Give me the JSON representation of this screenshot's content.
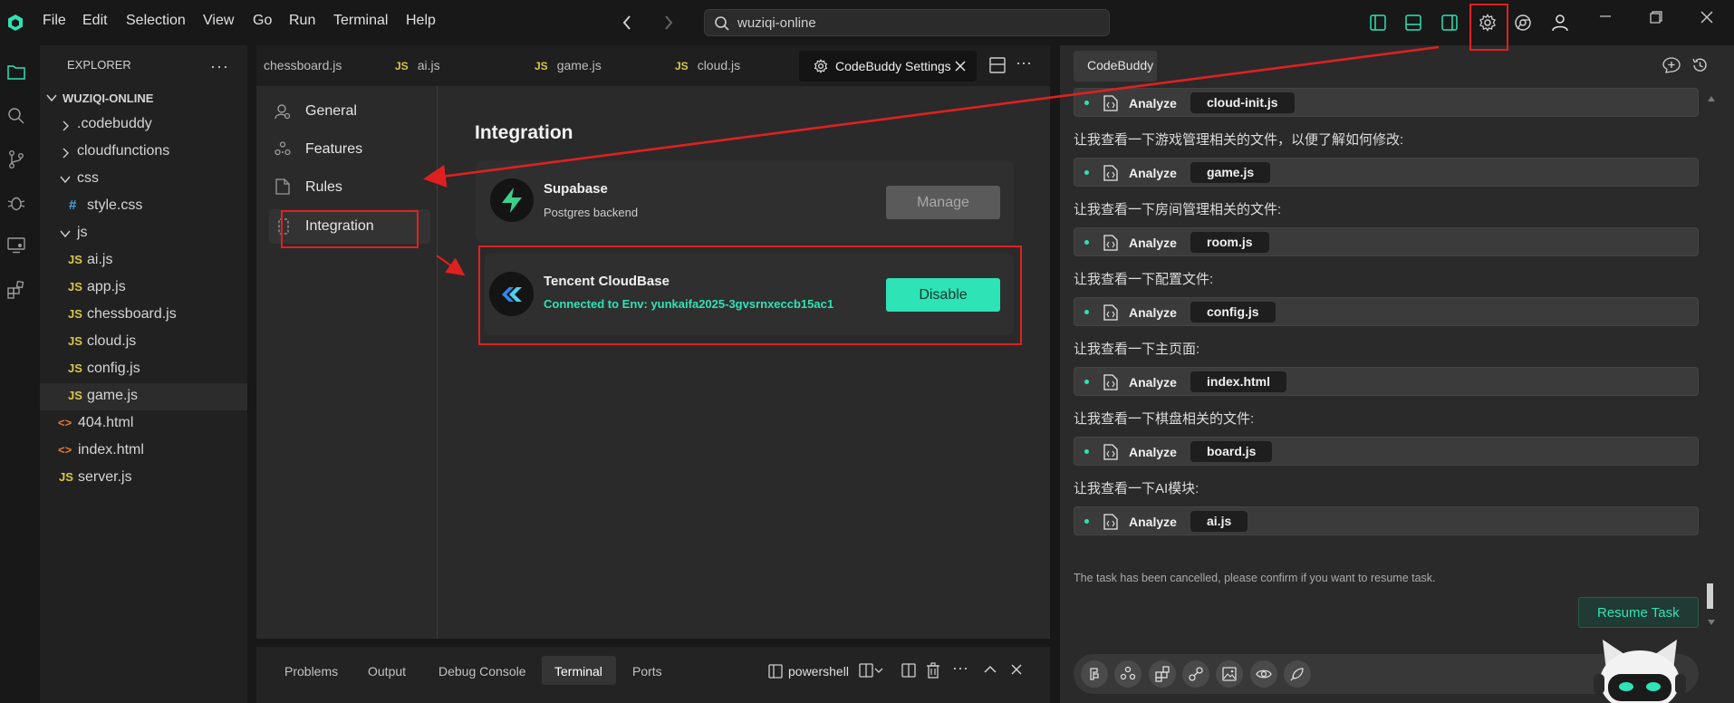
{
  "menu": [
    "File",
    "Edit",
    "Selection",
    "View",
    "Go",
    "Run",
    "Terminal",
    "Help"
  ],
  "search": {
    "value": "wuziqi-online"
  },
  "explorer": {
    "header": "EXPLORER",
    "root": "WUZIQI-ONLINE",
    "items": [
      {
        "label": ".codebuddy",
        "type": "folder-closed"
      },
      {
        "label": "cloudfunctions",
        "type": "folder-closed"
      },
      {
        "label": "css",
        "type": "folder-open"
      },
      {
        "label": "style.css",
        "type": "css"
      },
      {
        "label": "js",
        "type": "folder-open"
      },
      {
        "label": "ai.js",
        "type": "js"
      },
      {
        "label": "app.js",
        "type": "js"
      },
      {
        "label": "chessboard.js",
        "type": "js"
      },
      {
        "label": "cloud.js",
        "type": "js"
      },
      {
        "label": "config.js",
        "type": "js"
      },
      {
        "label": "game.js",
        "type": "js"
      },
      {
        "label": "404.html",
        "type": "html"
      },
      {
        "label": "index.html",
        "type": "html"
      },
      {
        "label": "server.js",
        "type": "js"
      }
    ]
  },
  "tabs": [
    {
      "label": "chessboard.js"
    },
    {
      "label": "ai.js"
    },
    {
      "label": "game.js"
    },
    {
      "label": "cloud.js"
    },
    {
      "label": "CodeBuddy Settings"
    }
  ],
  "js_badge": "JS",
  "settings": {
    "nav": [
      "General",
      "Features",
      "Rules",
      "Integration"
    ],
    "heading": "Integration",
    "integrations": [
      {
        "name": "Supabase",
        "desc": "Postgres backend",
        "button": "Manage"
      },
      {
        "name": "Tencent CloudBase",
        "desc": "Connected to Env: yunkaifa2025-3gvsrnxeccb15ac1",
        "button": "Disable"
      }
    ]
  },
  "panel": {
    "tabs": [
      "Problems",
      "Output",
      "Debug Console",
      "Terminal",
      "Ports"
    ],
    "shell": "powershell"
  },
  "codebuddy": {
    "title": "CodeBuddy",
    "analyze_label": "Analyze",
    "top_file": "cloud-init.js",
    "steps": [
      {
        "text": "让我查看一下游戏管理相关的文件，以便了解如何修改:",
        "file": "game.js"
      },
      {
        "text": "让我查看一下房间管理相关的文件:",
        "file": "room.js"
      },
      {
        "text": "让我查看一下配置文件:",
        "file": "config.js"
      },
      {
        "text": "让我查看一下主页面:",
        "file": "index.html"
      },
      {
        "text": "让我查看一下棋盘相关的文件:",
        "file": "board.js"
      },
      {
        "text": "让我查看一下AI模块:",
        "file": "ai.js"
      }
    ],
    "cancel_msg": "The task has been cancelled, please confirm if you want to resume task.",
    "resume_label": "Resume Task"
  },
  "colors": {
    "accent": "#2ee3b5",
    "highlight": "#e02020"
  }
}
